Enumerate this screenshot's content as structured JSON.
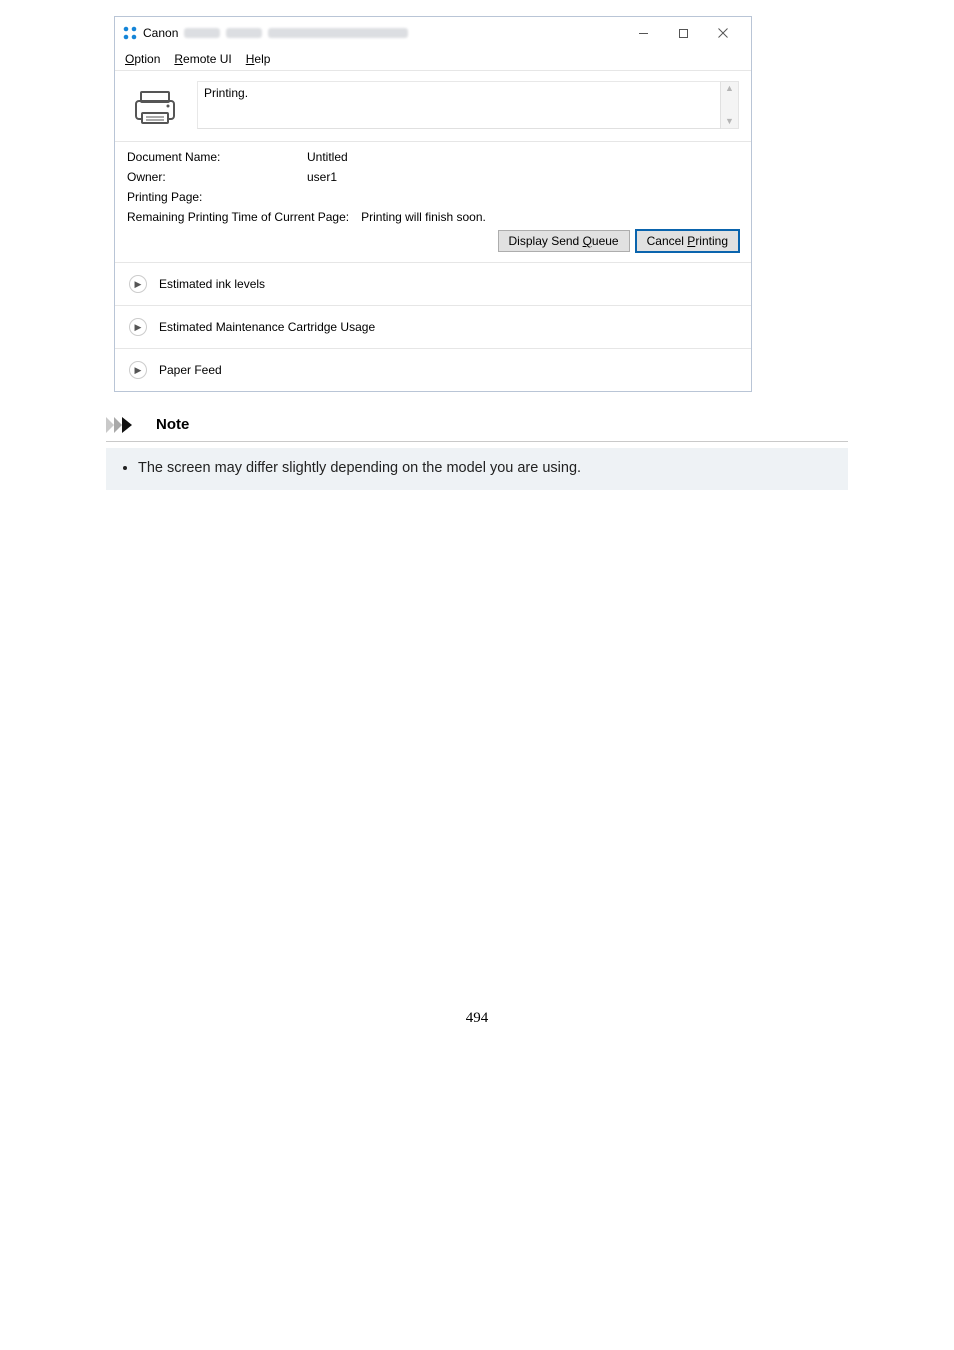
{
  "window": {
    "title_prefix": "Canon",
    "menu": {
      "option": "Option",
      "remote_ui": "Remote UI",
      "help": "Help"
    },
    "status_text": "Printing.",
    "info": {
      "doc_name_label": "Document Name:",
      "doc_name_value": "Untitled",
      "owner_label": "Owner:",
      "owner_value": "user1",
      "printing_page_label": "Printing Page:",
      "printing_page_value": "",
      "remaining_label": "Remaining Printing Time of Current Page:",
      "remaining_value": "Printing will finish soon."
    },
    "buttons": {
      "display_send_queue": "Display Send Queue",
      "cancel_printing": "Cancel Printing"
    },
    "expanders": {
      "ink": "Estimated ink levels",
      "maintenance": "Estimated Maintenance Cartridge Usage",
      "paper": "Paper Feed"
    }
  },
  "note": {
    "heading": "Note",
    "item1": "The screen may differ slightly depending on the model you are using."
  },
  "page_number": "494"
}
